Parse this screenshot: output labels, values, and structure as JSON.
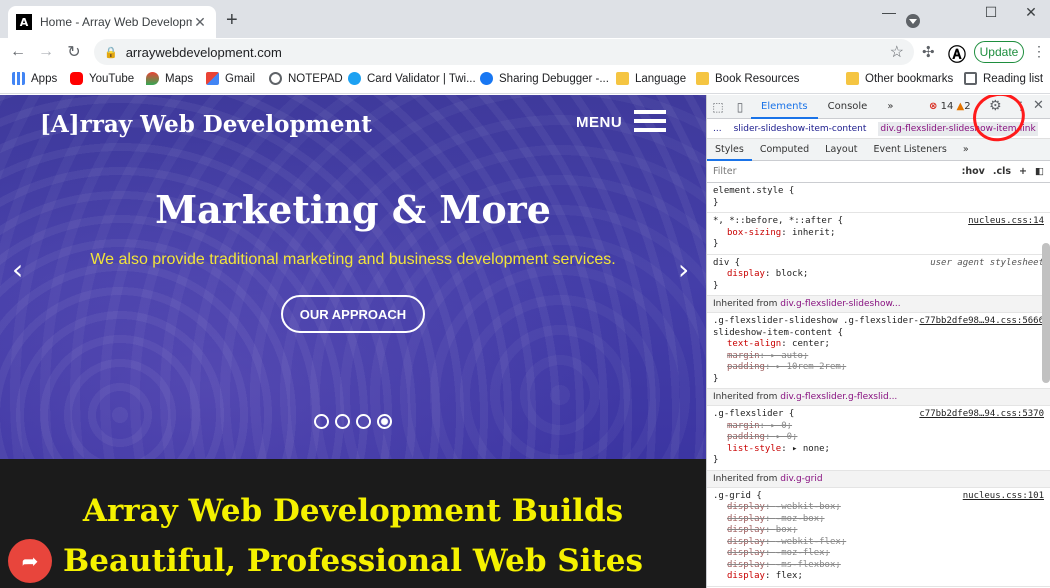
{
  "browser": {
    "tab_title": "Home - Array Web Development",
    "tab_favicon": "A",
    "new_tab_symbol": "+",
    "url": "arraywebdevelopment.com",
    "update_label": "Update",
    "window_controls": [
      "—",
      "☐",
      "✕"
    ]
  },
  "bookmarks": [
    {
      "label": "Apps",
      "icon": "apps-grid-icon",
      "color": "#4285f4"
    },
    {
      "label": "YouTube",
      "icon": "youtube-icon",
      "color": "#ff0000"
    },
    {
      "label": "Maps",
      "icon": "maps-icon",
      "color": "#34a853"
    },
    {
      "label": "Gmail",
      "icon": "gmail-icon",
      "color": "#ea4335"
    },
    {
      "label": "NOTEPAD",
      "icon": "globe-icon",
      "color": "#5f6368"
    },
    {
      "label": "Card Validator | Twi...",
      "icon": "twitter-icon",
      "color": "#1da1f2"
    },
    {
      "label": "Sharing Debugger -...",
      "icon": "facebook-icon",
      "color": "#1877f2"
    },
    {
      "label": "Language",
      "icon": "folder-icon",
      "color": "#f5c542"
    },
    {
      "label": "Book Resources",
      "icon": "folder-icon",
      "color": "#f5c542"
    },
    {
      "label": "Other bookmarks",
      "icon": "folder-icon",
      "color": "#f5c542"
    },
    {
      "label": "Reading list",
      "icon": "reading-list-icon",
      "color": "#5f6368"
    }
  ],
  "site": {
    "brand": "[A]rray Web Development",
    "menu_label": "MENU",
    "hero_title": "Marketing & More",
    "hero_subtitle": "We also provide traditional marketing and business development services.",
    "cta_label": "OUR APPROACH",
    "slide_count": 4,
    "active_slide": 4,
    "headline_line1": "Array Web Development Builds",
    "headline_line2": "Beautiful, Professional Web Sites",
    "hero_color": "#423ca6",
    "accent_yellow": "#f5f100"
  },
  "devtools": {
    "tabs": [
      "Elements",
      "Console",
      "»"
    ],
    "active_tab": "Elements",
    "errors": "14",
    "warnings": "2",
    "breadcrumbs": [
      "...",
      "slider-slideshow-item-content",
      "div.g-flexslider-slideshow-item-link"
    ],
    "sub_tabs": [
      "Styles",
      "Computed",
      "Layout",
      "Event Listeners",
      "»"
    ],
    "filter_placeholder": "Filter",
    "filter_hov": ":hov",
    "filter_cls": ".cls",
    "rules": [
      {
        "selector": "element.style {",
        "source": "",
        "props": []
      },
      {
        "selector": "*, *::before, *::after {",
        "source": "nucleus.css:14",
        "props": [
          {
            "name": "box-sizing",
            "value": "inherit;"
          }
        ]
      },
      {
        "selector": "div {",
        "source": "user agent stylesheet",
        "props": [
          {
            "name": "display",
            "value": "block;"
          }
        ]
      }
    ],
    "inherited1_label": "Inherited from",
    "inherited1_tag": "div.g-flexslider-slideshow...",
    "rule4_selector": ".g-flexslider-slideshow .g-flexslider-slideshow-item-content {",
    "rule4_source": "c77bb2dfe98…94.css:5666",
    "rule4_props": [
      {
        "name": "text-align",
        "value": "center;"
      },
      {
        "name": "margin",
        "value": "▸ auto;"
      },
      {
        "name": "padding",
        "value": "▸ 10rem 2rem;"
      }
    ],
    "inherited2_label": "Inherited from",
    "inherited2_tag": "div.g-flexslider.g-flexslid...",
    "rule5_selector": ".g-flexslider {",
    "rule5_source": "c77bb2dfe98…94.css:5370",
    "rule5_props": [
      {
        "name": "margin",
        "value": "▸ 0;"
      },
      {
        "name": "padding",
        "value": "▸ 0;"
      },
      {
        "name": "list-style",
        "value": "▸ none;"
      }
    ],
    "inherited3_label": "Inherited from",
    "inherited3_tag": "div.g-grid",
    "rule6_selector": ".g-grid {",
    "rule6_source": "nucleus.css:101",
    "rule6_props": [
      {
        "name": "display",
        "value": "-webkit-box;"
      },
      {
        "name": "display",
        "value": "-moz-box;"
      },
      {
        "name": "display",
        "value": "box;"
      },
      {
        "name": "display",
        "value": "-webkit-flex;"
      },
      {
        "name": "display",
        "value": "-moz-flex;"
      },
      {
        "name": "display",
        "value": "-ms-flexbox;"
      },
      {
        "name": "display",
        "value": "flex;"
      }
    ],
    "annotation_color": "#ff1a1a"
  }
}
